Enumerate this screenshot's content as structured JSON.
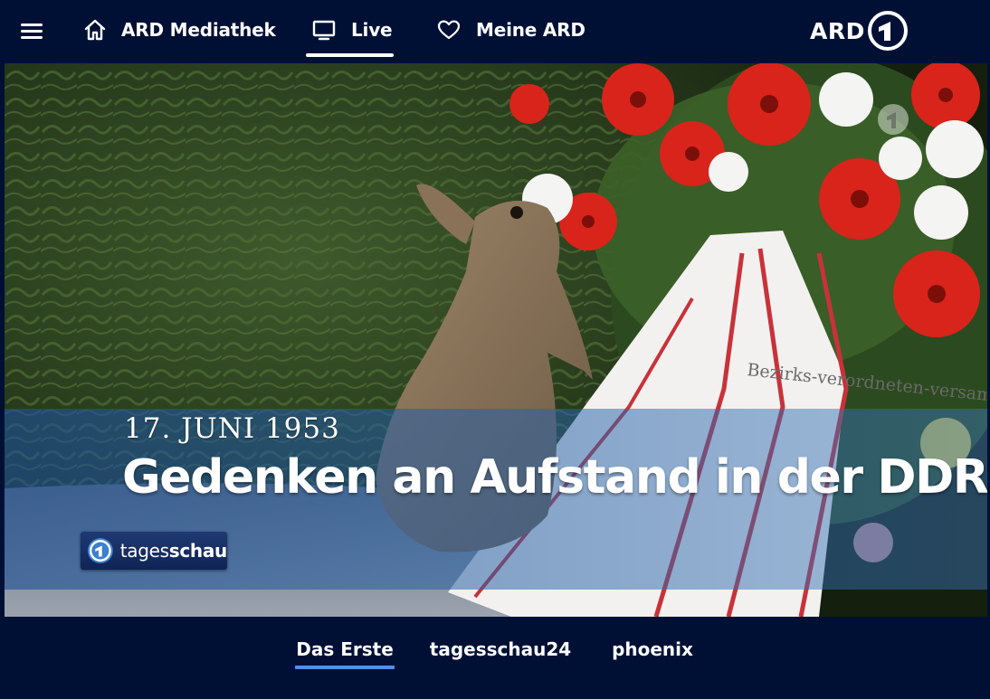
{
  "topbar": {
    "nav": [
      {
        "label": "ARD Mediathek",
        "icon": "home-icon"
      },
      {
        "label": "Live",
        "icon": "tv-icon",
        "active": true
      },
      {
        "label": "Meine ARD",
        "icon": "heart-icon"
      }
    ],
    "logo_text": "ARD"
  },
  "player": {
    "kicker": "17. JUNI 1953",
    "headline": "Gedenken an Aufstand in der DDR",
    "badge": {
      "part1": "tages",
      "part2": "schau"
    },
    "ribbon_text": "Bezirks-verordneten-versammlung"
  },
  "channels": {
    "tabs": [
      {
        "label": "Das Erste",
        "active": true
      },
      {
        "label": "tagesschau24"
      },
      {
        "label": "phoenix"
      }
    ]
  },
  "colors": {
    "background": "#001035",
    "accent": "#4f8fe6",
    "text": "#ffffff"
  }
}
